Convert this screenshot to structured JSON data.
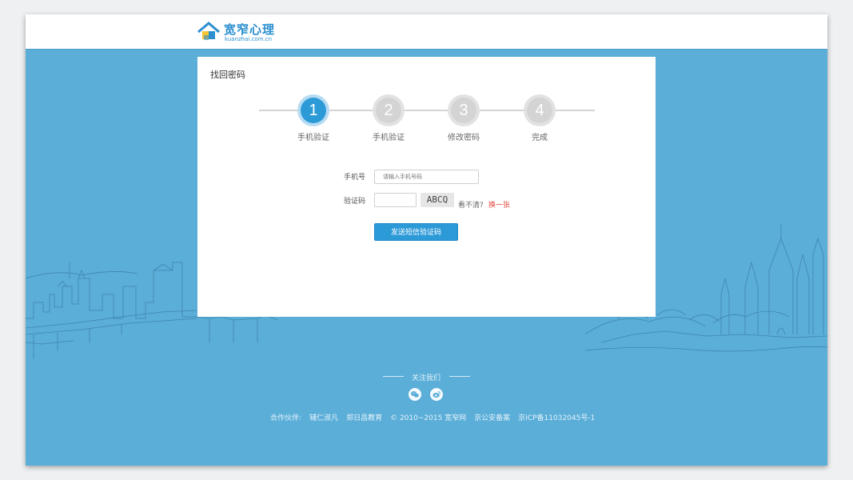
{
  "logo": {
    "name_cn": "宽窄心理",
    "domain": "kuanzhai.com.cn"
  },
  "card": {
    "title": "找回密码"
  },
  "steps": [
    {
      "number": "1",
      "label": "手机验证",
      "active": true
    },
    {
      "number": "2",
      "label": "手机验证",
      "active": false
    },
    {
      "number": "3",
      "label": "修改密码",
      "active": false
    },
    {
      "number": "4",
      "label": "完成",
      "active": false
    }
  ],
  "form": {
    "phone_label": "手机号",
    "phone_placeholder": "请输入手机号码",
    "code_label": "验证码",
    "code_value": "",
    "captcha_text": "ABCQ",
    "captcha_hint": "看不清?",
    "captcha_refresh": "换一张",
    "submit_label": "发送短信验证码"
  },
  "footer": {
    "follow_label": "关注我们",
    "social": [
      "wechat-icon",
      "weibo-icon"
    ],
    "partners_label": "合作伙伴:",
    "partner_1": "辅仁淑凡",
    "partner_2": "郑日昌教育",
    "copyright": "© 2010~2015 宽窄网",
    "icp_police": "京公安备案",
    "icp": "京ICP备11032045号-1"
  },
  "colors": {
    "accent": "#2d9ad8",
    "background": "#5aaed8",
    "link_red": "#e0453a"
  }
}
